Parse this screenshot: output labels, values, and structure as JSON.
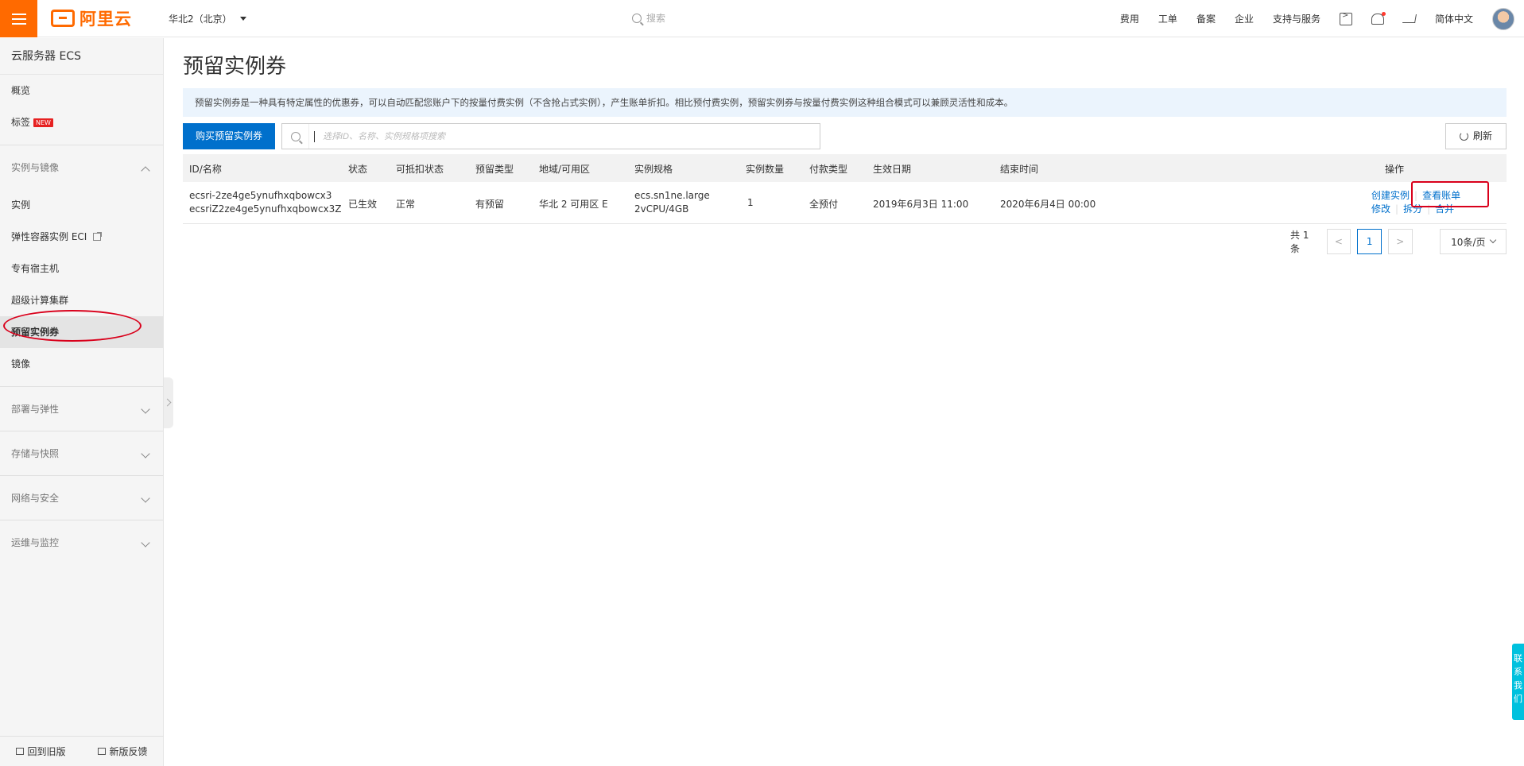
{
  "topbar": {
    "logo_text": "阿里云",
    "region": "华北2（北京）",
    "search_placeholder": "搜索",
    "nav": [
      "费用",
      "工单",
      "备案",
      "企业",
      "支持与服务"
    ],
    "language": "简体中文",
    "icons": [
      "terminal-icon",
      "bell-icon",
      "cart-icon"
    ]
  },
  "sidebar": {
    "title": "云服务器 ECS",
    "overview": "概览",
    "tags": "标签",
    "tags_badge": "NEW",
    "group_instances": "实例与镜像",
    "items": [
      "实例",
      "弹性容器实例 ECI",
      "专有宿主机",
      "超级计算集群",
      "预留实例券",
      "镜像"
    ],
    "active_item": "预留实例券",
    "groups": [
      "部署与弹性",
      "存储与快照",
      "网络与安全",
      "运维与监控"
    ],
    "footer_old": "回到旧版",
    "footer_feedback": "新版反馈"
  },
  "main": {
    "title": "预留实例券",
    "notice": "预留实例券是一种具有特定属性的优惠券，可以自动匹配您账户下的按量付费实例（不含抢占式实例），产生账单折扣。相比预付费实例，预留实例券与按量付费实例这种组合模式可以兼顾灵活性和成本。",
    "buy_button": "购买预留实例券",
    "search_placeholder": "选择ID、名称、实例规格项搜索",
    "refresh_button": "刷新",
    "table": {
      "headers": [
        "ID/名称",
        "状态",
        "可抵扣状态",
        "预留类型",
        "地域/可用区",
        "实例规格",
        "实例数量",
        "付款类型",
        "生效日期",
        "结束时间",
        "操作"
      ],
      "rows": [
        {
          "id": "ecsri-2ze4ge5ynufhxqbowcx3",
          "name": "ecsriZ2ze4ge5ynufhxqbowcx3Z",
          "status": "已生效",
          "deduct_status": "正常",
          "reserve_type": "有预留",
          "zone": "华北 2 可用区 E",
          "spec_line1": "ecs.sn1ne.large",
          "spec_line2": "2vCPU/4GB",
          "count": "1",
          "pay_type": "全预付",
          "start": "2019年6月3日 11:00",
          "end": "2020年6月4日 00:00",
          "actions_line1": [
            "创建实例",
            "查看账单"
          ],
          "actions_line2": [
            "修改",
            "拆分",
            "合并"
          ]
        }
      ]
    },
    "pager": {
      "total": "共 1 条",
      "current_page": "1",
      "page_size": "10条/页"
    }
  },
  "contact_tab": "联系我们",
  "colors": {
    "brand_orange": "#ff6a00",
    "primary_blue": "#0070cc",
    "annotation_red": "#d9001b"
  }
}
